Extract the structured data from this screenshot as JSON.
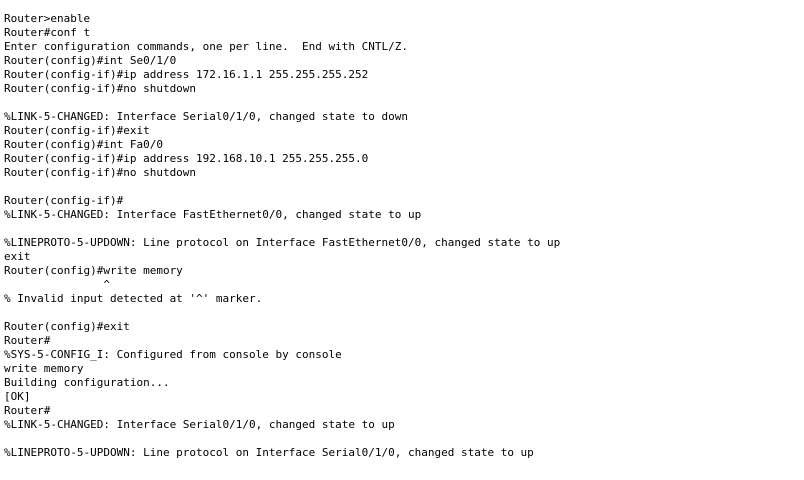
{
  "terminal": {
    "text_color": "#000000",
    "background_color": "#ffffff",
    "lines": [
      "Router>enable",
      "Router#conf t",
      "Enter configuration commands, one per line.  End with CNTL/Z.",
      "Router(config)#int Se0/1/0",
      "Router(config-if)#ip address 172.16.1.1 255.255.255.252",
      "Router(config-if)#no shutdown",
      "",
      "%LINK-5-CHANGED: Interface Serial0/1/0, changed state to down",
      "Router(config-if)#exit",
      "Router(config)#int Fa0/0",
      "Router(config-if)#ip address 192.168.10.1 255.255.255.0",
      "Router(config-if)#no shutdown",
      "",
      "Router(config-if)#",
      "%LINK-5-CHANGED: Interface FastEthernet0/0, changed state to up",
      "",
      "%LINEPROTO-5-UPDOWN: Line protocol on Interface FastEthernet0/0, changed state to up",
      "exit",
      "Router(config)#write memory",
      "               ^",
      "% Invalid input detected at '^' marker.",
      "",
      "Router(config)#exit",
      "Router#",
      "%SYS-5-CONFIG_I: Configured from console by console",
      "write memory",
      "Building configuration...",
      "[OK]",
      "Router#",
      "%LINK-5-CHANGED: Interface Serial0/1/0, changed state to up",
      "",
      "%LINEPROTO-5-UPDOWN: Line protocol on Interface Serial0/1/0, changed state to up"
    ]
  }
}
